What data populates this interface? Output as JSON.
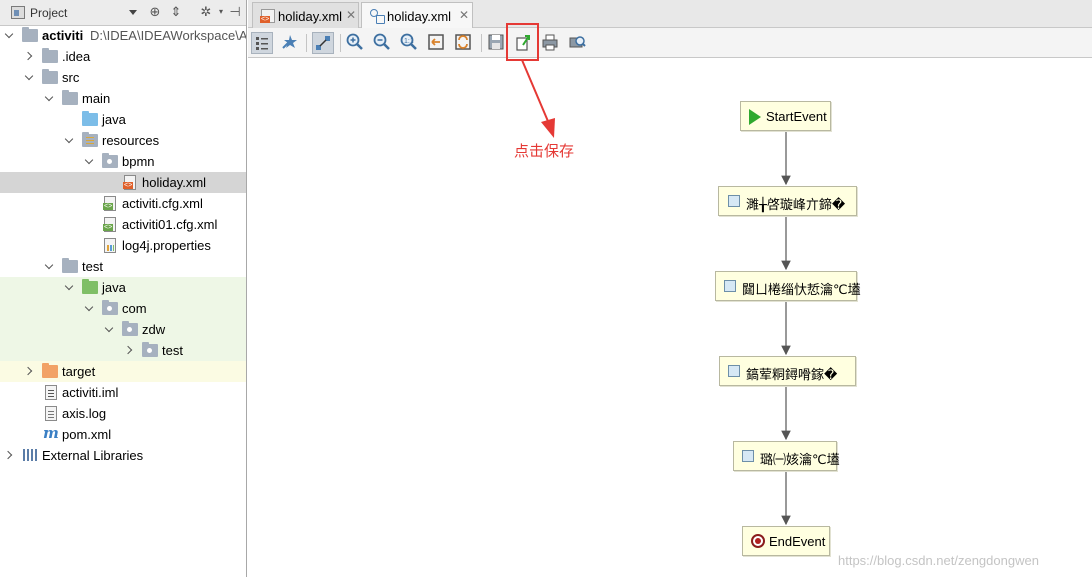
{
  "project_panel": {
    "title": "Project",
    "tree": [
      {
        "label": "activiti",
        "path": "D:\\IDEA\\IDEAWorkspace\\A",
        "icon": "module-folder-icon",
        "expanded": true
      },
      {
        "label": ".idea",
        "icon": "folder-icon",
        "expanded": false
      },
      {
        "label": "src",
        "icon": "folder-icon",
        "expanded": true
      },
      {
        "label": "main",
        "icon": "folder-icon",
        "expanded": true
      },
      {
        "label": "java",
        "icon": "source-folder-icon"
      },
      {
        "label": "resources",
        "icon": "resources-folder-icon",
        "expanded": true
      },
      {
        "label": "bpmn",
        "icon": "package-folder-icon",
        "expanded": true
      },
      {
        "label": "holiday.xml",
        "icon": "xml-file-icon",
        "selected": true
      },
      {
        "label": "activiti.cfg.xml",
        "icon": "config-xml-file-icon"
      },
      {
        "label": "activiti01.cfg.xml",
        "icon": "config-xml-file-icon"
      },
      {
        "label": "log4j.properties",
        "icon": "properties-file-icon"
      },
      {
        "label": "test",
        "icon": "folder-icon",
        "expanded": true
      },
      {
        "label": "java",
        "icon": "test-source-folder-icon",
        "expanded": true
      },
      {
        "label": "com",
        "icon": "package-folder-icon",
        "expanded": true
      },
      {
        "label": "zdw",
        "icon": "package-folder-icon",
        "expanded": true
      },
      {
        "label": "test",
        "icon": "package-folder-icon",
        "expanded": false
      },
      {
        "label": "target",
        "icon": "excluded-folder-icon",
        "expanded": false
      },
      {
        "label": "activiti.iml",
        "icon": "iml-file-icon"
      },
      {
        "label": "axis.log",
        "icon": "log-file-icon"
      },
      {
        "label": "pom.xml",
        "icon": "maven-icon"
      },
      {
        "label": "External Libraries",
        "icon": "libraries-icon",
        "expanded": false
      }
    ]
  },
  "editor": {
    "tabs": [
      {
        "label": "holiday.xml",
        "icon": "xml-file-icon",
        "active": false
      },
      {
        "label": "holiday.xml",
        "icon": "bpmn-designer-icon",
        "active": true
      }
    ],
    "toolbar": [
      "structure-view-icon",
      "select-icon",
      "connect-icon",
      "zoom-in-icon",
      "zoom-out-icon",
      "actual-size-icon",
      "fit-icon",
      "layout-icon",
      "save-icon",
      "export-icon",
      "print-icon",
      "preview-icon"
    ]
  },
  "diagram": {
    "nodes": [
      {
        "type": "start",
        "label": "StartEvent"
      },
      {
        "type": "task",
        "label": "濉╁啓璇峰亣鍗�"
      },
      {
        "type": "task",
        "label": "閮ㄩ棬缁忕悊瀹℃壒"
      },
      {
        "type": "task",
        "label": "鎬荤粡鐞嗗鎵�"
      },
      {
        "type": "task",
        "label": "璐㈠姟瀹℃壒"
      },
      {
        "type": "end",
        "label": "EndEvent"
      }
    ]
  },
  "annotation": {
    "text": "点击保存",
    "color": "#e53935"
  },
  "watermark": "https://blog.csdn.net/zengdongwen",
  "colors": {
    "selection": "#d5d5d5",
    "test_source_bg": "#eef7e6",
    "excluded_bg": "#fbfbe3",
    "node_fill": "#ffffe0",
    "start_green": "#2fa92f",
    "end_red": "#b02020"
  }
}
